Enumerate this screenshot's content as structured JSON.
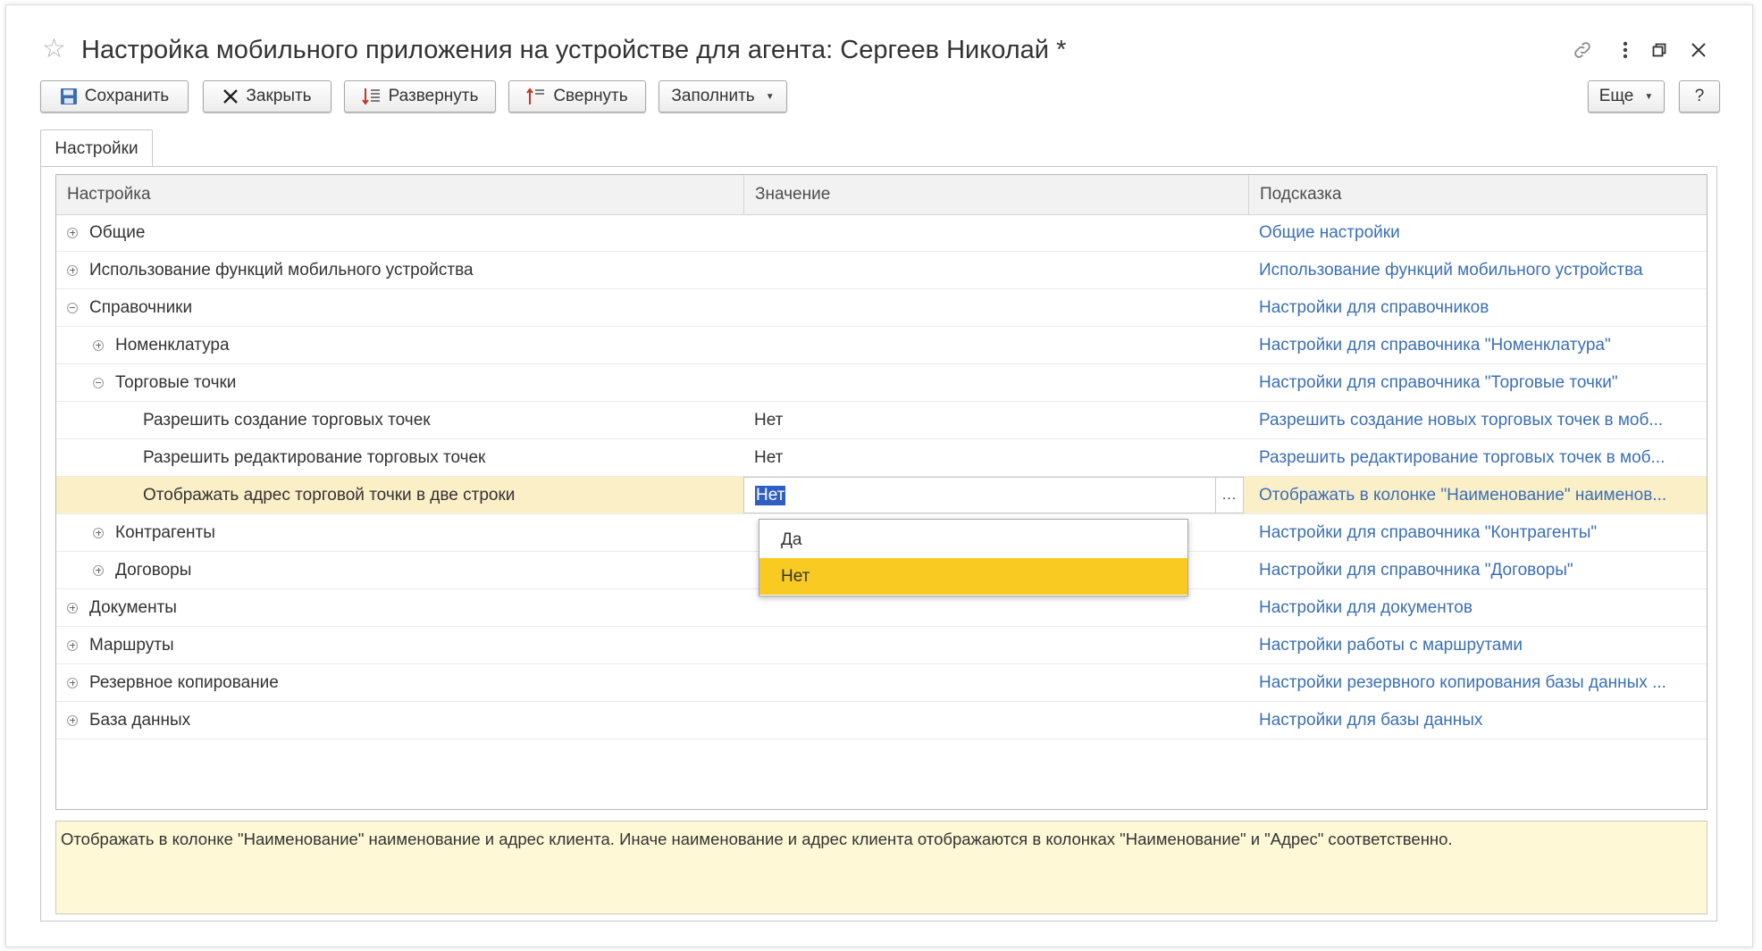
{
  "window": {
    "title": "Настройка мобильного приложения на устройстве для агента: Сергеев Николай *"
  },
  "toolbar": {
    "save_label": "Сохранить",
    "close_label": "Закрыть",
    "expand_label": "Развернуть",
    "collapse_label": "Свернуть",
    "fill_label": "Заполнить",
    "more_label": "Еще",
    "help_label": "?"
  },
  "tabs": [
    {
      "label": "Настройки",
      "active": true
    }
  ],
  "table": {
    "columns": {
      "setting": "Настройка",
      "value": "Значение",
      "hint": "Подсказка"
    },
    "rows": [
      {
        "name": "Общие",
        "value": "",
        "hint": "Общие настройки",
        "level": 0,
        "node": "plus"
      },
      {
        "name": "Использование функций мобильного устройства",
        "value": "",
        "hint": "Использование функций мобильного устройства",
        "level": 0,
        "node": "plus"
      },
      {
        "name": "Справочники",
        "value": "",
        "hint": "Настройки для справочников",
        "level": 0,
        "node": "minus"
      },
      {
        "name": "Номенклатура",
        "value": "",
        "hint": "Настройки для справочника \"Номенклатура\"",
        "level": 1,
        "node": "plus"
      },
      {
        "name": "Торговые точки",
        "value": "",
        "hint": "Настройки для справочника \"Торговые точки\"",
        "level": 1,
        "node": "minus"
      },
      {
        "name": "Разрешить создание торговых точек",
        "value": "Нет",
        "hint": "Разрешить создание новых торговых точек в моб...",
        "level": 2,
        "node": "none"
      },
      {
        "name": "Разрешить редактирование торговых точек",
        "value": "Нет",
        "hint": "Разрешить редактирование торговых точек в моб...",
        "level": 2,
        "node": "none"
      },
      {
        "name": "Отображать адрес торговой точки в две строки",
        "value": "Нет",
        "hint": "Отображать в колонке \"Наименование\" наименов...",
        "level": 2,
        "node": "none",
        "selected": true
      },
      {
        "name": "Контрагенты",
        "value": "",
        "hint": "Настройки для справочника \"Контрагенты\"",
        "level": 1,
        "node": "plus"
      },
      {
        "name": "Договоры",
        "value": "",
        "hint": "Настройки для справочника \"Договоры\"",
        "level": 1,
        "node": "plus"
      },
      {
        "name": "Документы",
        "value": "",
        "hint": "Настройки для документов",
        "level": 0,
        "node": "plus"
      },
      {
        "name": "Маршруты",
        "value": "",
        "hint": "Настройки работы с маршрутами",
        "level": 0,
        "node": "plus"
      },
      {
        "name": "Резервное копирование",
        "value": "",
        "hint": "Настройки резервного копирования базы данных ...",
        "level": 0,
        "node": "plus"
      },
      {
        "name": "База данных",
        "value": "",
        "hint": "Настройки для базы данных",
        "level": 0,
        "node": "plus"
      }
    ]
  },
  "dropdown": {
    "options": [
      "Да",
      "Нет"
    ],
    "highlighted": "Нет"
  },
  "description": "Отображать в колонке \"Наименование\" наименование и адрес клиента. Иначе наименование и адрес клиента отображаются в колонках \"Наименование\" и \"Адрес\" соответственно.",
  "colors": {
    "hint_link": "#3b6fb6",
    "selected_row": "#fbefc7",
    "dropdown_active": "#f9cb22",
    "description_bg": "#fef8d6"
  }
}
